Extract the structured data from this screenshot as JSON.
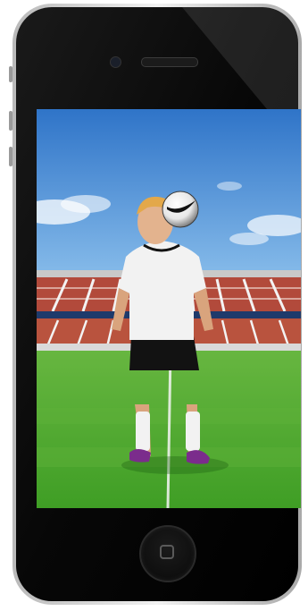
{
  "device": {
    "model": "iPhone 4",
    "body_color": "#0b0b0b",
    "bezel_color": "#d7d7d7"
  },
  "icons": {
    "speaker": "speaker-grille-icon",
    "camera": "front-camera-icon",
    "home": "home-button-icon"
  },
  "scene": {
    "sky_color": "#3f8fd6",
    "grass_color": "#4fae2c",
    "stand_color": "#b24a3b",
    "jersey_color": "#f2f2f2",
    "shorts_color": "#121212",
    "boots_color": "#7b2c8c",
    "ball_brand": "swoosh-logo-icon"
  }
}
